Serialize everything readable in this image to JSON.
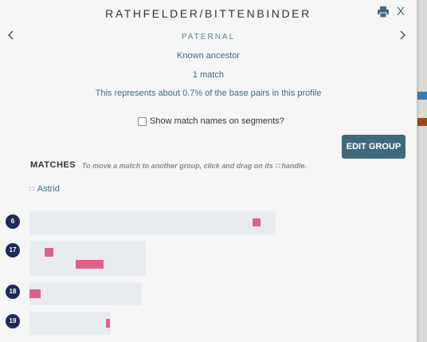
{
  "window": {
    "title": "RATHFELDER/BITTENBINDER",
    "close_label": "X",
    "print_icon": "print-icon",
    "prev_icon": "chevron-left-icon",
    "next_icon": "chevron-right-icon"
  },
  "group": {
    "lineage": "PATERNAL",
    "ancestor_status": "Known ancestor",
    "match_count": "1 match",
    "shared_note": "This represents about 0.7% of the base pairs in this profile",
    "shared_percent": 0.7
  },
  "options": {
    "show_names_label": "Show match names on segments?",
    "show_names_checked": false
  },
  "toolbar": {
    "edit_group_label": "EDIT GROUP"
  },
  "matches": {
    "heading": "MATCHES",
    "hint": "To move a match to another group, click and drag on its ∷ handle.",
    "members": [
      {
        "name": "Astrid"
      }
    ]
  },
  "chromosomes": [
    {
      "label": "6"
    },
    {
      "label": "17"
    },
    {
      "label": "18"
    },
    {
      "label": "19"
    }
  ],
  "colors": {
    "accent": "#3e6a7e",
    "segment": "#e0608a",
    "badge": "#1d2a5b",
    "bar": "#e8ecf1"
  }
}
